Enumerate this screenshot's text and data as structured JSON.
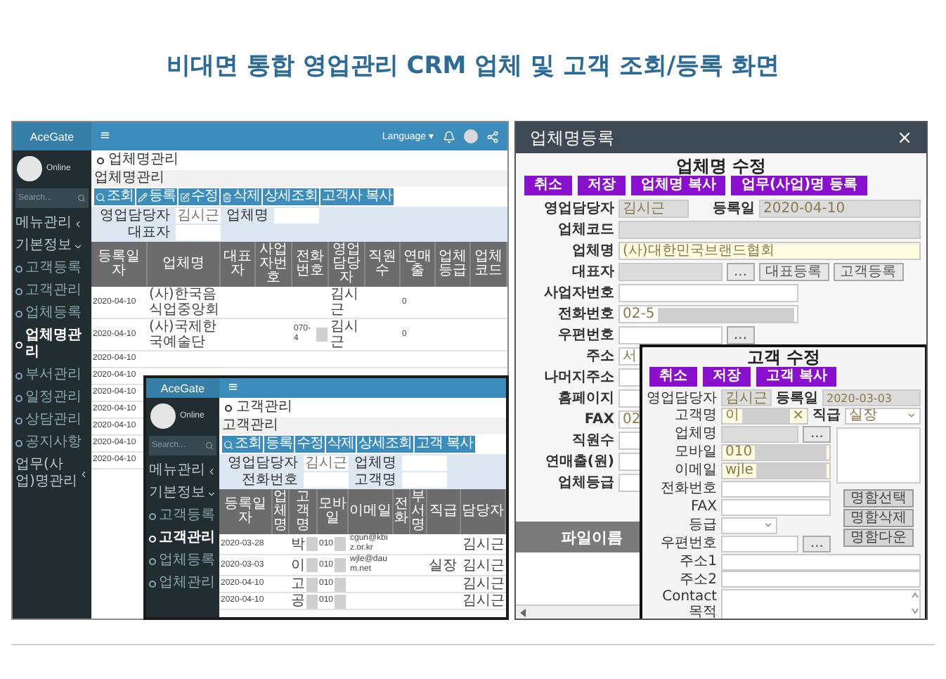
{
  "title": "비대면 통합 영업관리 CRM 업체 및 고객 조회/등록 화면",
  "company_app": {
    "logo": "AceGate",
    "menu_glyph": "≡",
    "language": "Language ▾",
    "user_status": "Online",
    "search_placeholder": "Search...",
    "menu": [
      {
        "label": "메뉴관리",
        "expanded": false
      },
      {
        "label": "기본정보",
        "expanded": true,
        "children": [
          {
            "label": "고객등록",
            "selected": false
          },
          {
            "label": "고객관리",
            "selected": false
          },
          {
            "label": "업체등록",
            "selected": false
          },
          {
            "label": "업체명관리",
            "selected": true
          },
          {
            "label": "부서관리",
            "selected": false
          },
          {
            "label": "일정관리",
            "selected": false
          },
          {
            "label": "상담관리",
            "selected": false
          },
          {
            "label": "공지사항",
            "selected": false
          }
        ]
      },
      {
        "label": "업무(사업)명관리",
        "expanded": false
      }
    ],
    "page_title": "업체명관리",
    "section_label": "업체명관리",
    "toolbar": [
      "조회",
      "등록",
      "수정",
      "삭제",
      "상세조회",
      "고객사 복사"
    ],
    "filters": [
      {
        "label": "영업담당자",
        "value": "김시근"
      },
      {
        "label": "업체명"
      },
      {
        "label": "대표자"
      }
    ],
    "table": {
      "columns": [
        "등록일자",
        "업체명",
        "대표자",
        "사업자번호",
        "전화번호",
        "영업담당자",
        "직원수",
        "연매출",
        "업체등급",
        "업체코드"
      ],
      "rows": [
        {
          "cells": [
            "2020-04-10",
            "(사)한국음식업중앙회",
            null,
            null,
            null,
            "김시근",
            null,
            "0",
            null,
            null
          ]
        },
        {
          "cells": [
            "2020-04-10",
            "(사)국제한국예술단",
            null,
            null,
            {
              "text": "070-4",
              "masked": true
            },
            "김시근",
            null,
            "0",
            null,
            null
          ]
        },
        {
          "cells": [
            "2020-04-10"
          ]
        },
        {
          "cells": [
            "2020-04-10"
          ]
        },
        {
          "cells": [
            "2020-04-10"
          ]
        },
        {
          "cells": [
            "2020-04-10"
          ]
        },
        {
          "cells": [
            "2020-04-10"
          ]
        },
        {
          "cells": [
            "2020-04-10"
          ]
        },
        {
          "cells": [
            "2020-04-10"
          ]
        }
      ]
    }
  },
  "customer_app": {
    "logo": "AceGate",
    "menu_glyph": "≡",
    "user_status": "Online",
    "search_placeholder": "Search...",
    "menu": [
      {
        "label": "메뉴관리",
        "expanded": false
      },
      {
        "label": "기본정보",
        "expanded": true,
        "children": [
          {
            "label": "고객등록",
            "selected": false
          },
          {
            "label": "고객관리",
            "selected": true
          },
          {
            "label": "업체등록",
            "selected": false
          },
          {
            "label": "업체관리",
            "selected": false
          }
        ]
      }
    ],
    "page_title": "고객관리",
    "section_label": "고객관리",
    "toolbar": [
      "조회",
      "등록",
      "수정",
      "삭제",
      "상세조회",
      "고객 복사"
    ],
    "filters": [
      {
        "label": "영업담당자",
        "value": "김시근"
      },
      {
        "label": "업체명"
      },
      {
        "label": "전화번호"
      },
      {
        "label": "고객명"
      }
    ],
    "table": {
      "columns": [
        "등록일자",
        "업체명",
        "고객명",
        "모바일",
        "이메일",
        "전화",
        "부서명",
        "직급",
        "담당자"
      ],
      "rows": [
        {
          "cells": [
            "2020-03-28",
            null,
            {
              "text": "박",
              "masked": true
            },
            {
              "text": "010",
              "masked": true
            },
            "cgun@kbiz.or.kr",
            null,
            null,
            null,
            "김시근"
          ]
        },
        {
          "cells": [
            "2020-03-03",
            null,
            {
              "text": "이",
              "masked": true
            },
            {
              "text": "010",
              "masked": true
            },
            "wjle@daum.net",
            null,
            null,
            "실장",
            "김시근"
          ]
        },
        {
          "cells": [
            "2020-04-10",
            null,
            {
              "text": "고",
              "masked": true
            },
            {
              "text": "010",
              "masked": true
            },
            null,
            null,
            null,
            null,
            "김시근"
          ]
        },
        {
          "cells": [
            "2020-04-10",
            null,
            {
              "text": "공",
              "masked": true
            },
            {
              "text": "010",
              "masked": true
            },
            null,
            null,
            null,
            null,
            "김시근"
          ]
        }
      ]
    }
  },
  "company_dialog": {
    "title": "업체명등록",
    "close": "×",
    "form_title": "업체명 수정",
    "buttons": [
      "취소",
      "저장",
      "업체명 복사",
      "업무(사업)명 등록"
    ],
    "fields": [
      {
        "kind": "pair",
        "label": "영업담당자",
        "value": "김시근",
        "second_label": "등록일",
        "second_value": "2020-04-10",
        "readonly": true,
        "required": false
      },
      {
        "kind": "field",
        "label": "업체코드",
        "readonly": true,
        "required": false
      },
      {
        "kind": "field",
        "label": "업체명",
        "value": "(사)대한민국브랜드협회",
        "required": true
      },
      {
        "kind": "lookup",
        "label": "대표자",
        "button_text": "...",
        "buttons": [
          "대표등록",
          "고객등록"
        ],
        "readonly": true,
        "required": false
      },
      {
        "kind": "field",
        "label": "사업자번호",
        "readonly": false,
        "required": false
      },
      {
        "kind": "field",
        "label": "전화번호",
        "value": "02-5",
        "masked": true,
        "readonly": false,
        "required": false
      },
      {
        "kind": "lookup",
        "label": "우편번호",
        "button_text": "...",
        "readonly": false,
        "required": false
      },
      {
        "kind": "field",
        "label": "주소",
        "value": "서",
        "readonly": false,
        "required": false
      },
      {
        "kind": "field",
        "label": "나머지주소",
        "readonly": false,
        "required": false
      },
      {
        "kind": "field",
        "label": "홈페이지",
        "readonly": false,
        "required": false
      },
      {
        "kind": "field",
        "label": "FAX",
        "value": "02",
        "readonly": false,
        "required": false
      },
      {
        "kind": "field",
        "label": "직원수",
        "readonly": false,
        "required": false
      },
      {
        "kind": "field",
        "label": "연매출(원)",
        "readonly": false,
        "required": false
      },
      {
        "kind": "field",
        "label": "업체등급",
        "readonly": false,
        "required": false
      }
    ],
    "file_header": "파일이름"
  },
  "customer_dialog": {
    "title": "고객 수정",
    "buttons": [
      "취소",
      "저장",
      "고객 복사"
    ],
    "top_fields": [
      {
        "kind": "pair",
        "label": "영업담당자",
        "value": "김시근",
        "second_label": "등록일",
        "second_value": "2020-03-03",
        "readonly": true,
        "required": false
      },
      {
        "kind": "name",
        "label": "고객명",
        "value": "이",
        "masked": true,
        "clear": "×",
        "second_label": "직급",
        "select_value": "실장",
        "required": true
      }
    ],
    "left_fields": [
      {
        "kind": "lookup",
        "label": "업체명",
        "button_text": "...",
        "readonly": true,
        "required": false
      },
      {
        "kind": "field",
        "label": "모바일",
        "value": "010",
        "masked": true,
        "required": true
      },
      {
        "kind": "field",
        "label": "이메일",
        "value": "wjle",
        "masked": true,
        "required": true
      },
      {
        "kind": "field",
        "label": "전화번호",
        "readonly": false,
        "required": false
      },
      {
        "kind": "field",
        "label": "FAX",
        "readonly": false,
        "required": false
      },
      {
        "kind": "select",
        "label": "등급",
        "readonly": false,
        "required": false
      },
      {
        "kind": "lookup",
        "label": "우편번호",
        "button_text": "...",
        "readonly": false,
        "required": false
      }
    ],
    "card_buttons": [
      "명함선택",
      "명함삭제",
      "명함다운"
    ],
    "bottom_fields": [
      {
        "kind": "field",
        "label": "주소1",
        "readonly": false,
        "required": false
      },
      {
        "kind": "field",
        "label": "주소2",
        "readonly": false,
        "required": false
      },
      {
        "kind": "textarea",
        "label": "Contact 목적",
        "readonly": false,
        "required": false
      }
    ]
  }
}
